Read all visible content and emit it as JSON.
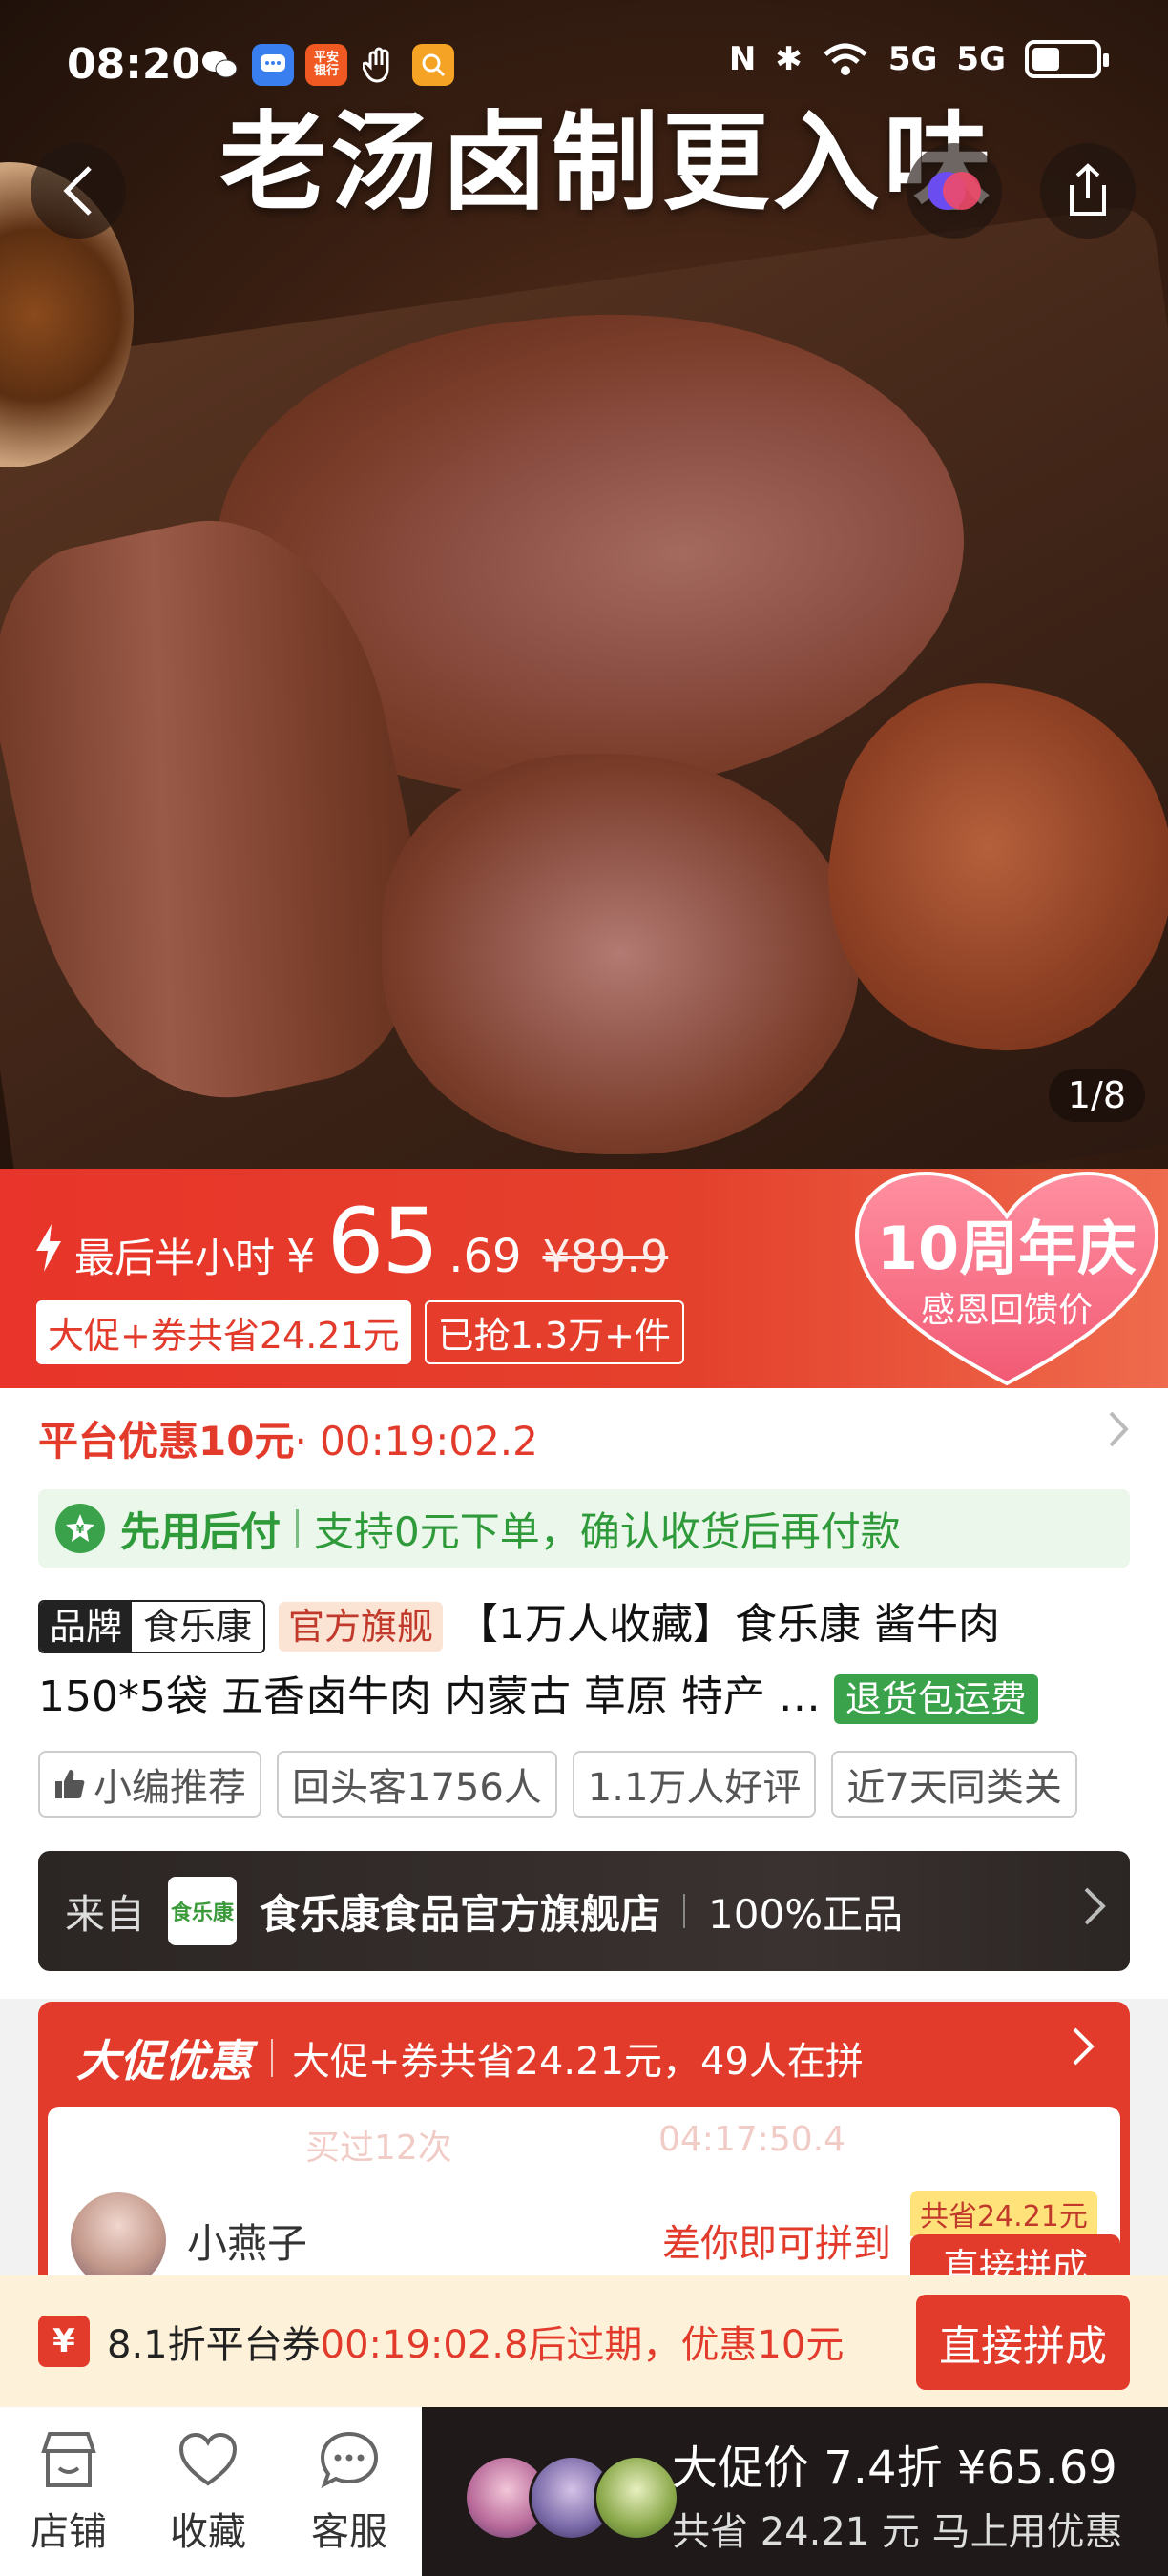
{
  "status_bar": {
    "time": "08:20",
    "bank_badge": "平安\n银行",
    "signal1": "5G",
    "signal2": "5G"
  },
  "hero": {
    "caption": "老汤卤制更入味",
    "pager": "1/8"
  },
  "price": {
    "tag": "最后半小时",
    "currency": "¥",
    "integer": "65",
    "decimal": ".69",
    "original": "¥89.9",
    "chip_saving": "大促+券共省24.21元",
    "chip_sold": "已抢1.3万+件",
    "anniv_title": "10周年庆",
    "anniv_sub": "感恩回馈价"
  },
  "promo": {
    "label": "平台优惠10元",
    "countdown": "· 00:19:02.2"
  },
  "pay_later": {
    "title": "先用后付",
    "desc": "支持0元下单，确认收货后再付款"
  },
  "product": {
    "brand_key": "品牌",
    "brand_value": "食乐康",
    "official": "官方旗舰",
    "title": "【1万人收藏】食乐康 酱牛肉 150*5袋 五香卤牛肉 内蒙古 草原 特产 …",
    "return_badge": "退货包运费"
  },
  "tags": [
    "小编推荐",
    "回头客1756人",
    "1.1万人好评",
    "近7天同类关"
  ],
  "store": {
    "from": "来自",
    "logo_text": "食乐康",
    "name": "食乐康食品官方旗舰店",
    "auth": "100%正品"
  },
  "big_promo": {
    "logo": "大促优惠",
    "text": "大促+券共省24.21元，49人在拼",
    "ghost_bought": "买过12次",
    "ghost_time": "04:17:50.4",
    "group_name": "小燕子",
    "group_need": "差你即可拼到",
    "group_saved": "共省24.21元",
    "group_btn": "直接拼成"
  },
  "coupon": {
    "icon": "¥",
    "text_prefix": "8.1折平台券",
    "text_time": "00:19:02.8后过期，",
    "text_suffix": "优惠10元",
    "button": "直接拼成"
  },
  "bottom": {
    "store": "店铺",
    "favorite": "收藏",
    "service": "客服",
    "cta_line1": "大促价 7.4折 ¥65.69",
    "cta_line2": "共省 24.21 元 马上用优惠"
  },
  "colors": {
    "accent_red": "#e23a2b",
    "green": "#3aa24a",
    "dark_bar": "#1f1a19"
  }
}
